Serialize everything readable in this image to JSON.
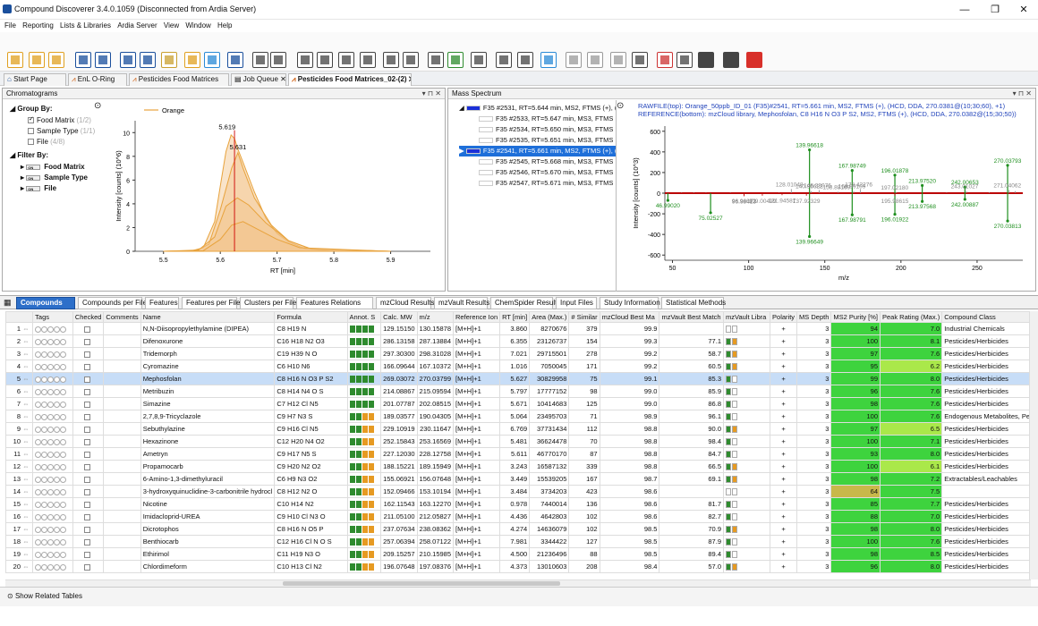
{
  "window": {
    "title": "Compound Discoverer 3.4.0.1059  (Disconnected from Ardia Server)",
    "minimize": "—",
    "maximize": "❐",
    "close": "✕"
  },
  "menu": [
    "File",
    "Reporting",
    "Lists & Libraries",
    "Ardia Server",
    "View",
    "Window",
    "Help"
  ],
  "doc_tabs": [
    {
      "label": "Start Page"
    },
    {
      "label": "EnL O-Ring"
    },
    {
      "label": "Pesticides Food Matrices"
    },
    {
      "label": "Job Queue"
    },
    {
      "label": "Pesticides Food Matrices_02-(2)"
    }
  ],
  "chromatograms": {
    "title": "Chromatograms",
    "group_by": "Group By:",
    "groups": [
      {
        "label": "Food Matrix",
        "count": "(1/2)",
        "checked": true
      },
      {
        "label": "Sample Type",
        "count": "(1/1)",
        "checked": false
      },
      {
        "label": "File",
        "count": "(4/8)",
        "checked": false
      }
    ],
    "filter_by": "Filter By:",
    "filters": [
      "Food Matrix",
      "Sample Type",
      "File"
    ],
    "legend": "Orange",
    "xlabel": "RT [min]",
    "ylabel": "Intensity [counts] (10^6)",
    "peak_labels": [
      "5.619",
      "5.631"
    ],
    "switch_text": "ON"
  },
  "chart_data": [
    {
      "type": "line",
      "title": "",
      "xlabel": "RT [min]",
      "ylabel": "Intensity [counts] (10^6)",
      "xlim": [
        5.45,
        5.97
      ],
      "ylim": [
        0,
        11
      ],
      "xticks": [
        5.5,
        5.6,
        5.7,
        5.8,
        5.9
      ],
      "yticks": [
        0,
        2,
        4,
        6,
        8,
        10
      ],
      "series": [
        {
          "name": "Orange",
          "x": [
            5.5,
            5.55,
            5.57,
            5.59,
            5.6,
            5.61,
            5.619,
            5.625,
            5.631,
            5.64,
            5.66,
            5.68,
            5.7,
            5.72,
            5.75,
            5.8,
            5.9
          ],
          "y": [
            0,
            0.05,
            0.3,
            2.5,
            5.5,
            8.4,
            9.8,
            9.5,
            8.6,
            7.5,
            5.0,
            2.8,
            1.5,
            0.8,
            0.2,
            0,
            0
          ]
        },
        {
          "name": "",
          "x": [
            5.5,
            5.56,
            5.58,
            5.6,
            5.62,
            5.631,
            5.64,
            5.66,
            5.69,
            5.72,
            5.76,
            5.9
          ],
          "y": [
            0,
            0.1,
            0.6,
            3.5,
            7.0,
            8.3,
            7.0,
            4.5,
            2.2,
            0.9,
            0.2,
            0
          ]
        },
        {
          "name": "",
          "x": [
            5.5,
            5.56,
            5.59,
            5.61,
            5.63,
            5.65,
            5.68,
            5.72,
            5.76,
            5.9
          ],
          "y": [
            0,
            0.05,
            1.2,
            3.8,
            4.5,
            3.9,
            2.4,
            0.9,
            0.2,
            0
          ]
        },
        {
          "name": "",
          "x": [
            5.5,
            5.57,
            5.6,
            5.62,
            5.64,
            5.66,
            5.7,
            5.74,
            5.9
          ],
          "y": [
            0,
            0.05,
            1.0,
            2.2,
            2.5,
            2.0,
            1.0,
            0.3,
            0
          ]
        }
      ]
    },
    {
      "type": "bar",
      "title": "",
      "xlabel": "m/z",
      "ylabel": "Intensity [counts] (10^3)",
      "xlim": [
        45,
        280
      ],
      "ylim": [
        -650,
        650
      ],
      "xticks": [
        50,
        100,
        150,
        200,
        250
      ],
      "yticks": [
        -600,
        -400,
        -200,
        0,
        200,
        400,
        600
      ],
      "series": [
        {
          "name": "top",
          "x": [
            139.96618,
            167.98749,
            196.01878,
            270.03793,
            213.9752,
            242.00653,
            128.01048,
            146.33076,
            173.42276,
            197.0218,
            243.01027,
            271.04062,
            140.96622,
            168.99109,
            158.88169,
            56.0,
            64.0,
            72.0,
            88.0,
            120.0,
            230.0,
            258.0,
            275.0
          ],
          "y": [
            420,
            220,
            175,
            270,
            75,
            60,
            40,
            30,
            40,
            10,
            20,
            30,
            20,
            20,
            15,
            5,
            6,
            4,
            5,
            5,
            5,
            10,
            20
          ]
        },
        {
          "name": "bottom",
          "x": [
            139.96649,
            167.98791,
            196.01922,
            270.03813,
            213.97568,
            242.00887,
            75.02527,
            46.9902,
            96.96072,
            96.98413,
            109.00499,
            121.94587,
            137.92329,
            195.98615
          ],
          "y": [
            -420,
            -210,
            -205,
            -270,
            -80,
            -60,
            -190,
            -70,
            -25,
            -30,
            -25,
            -20,
            -25,
            -25
          ]
        }
      ]
    }
  ],
  "mass_spectrum": {
    "title": "Mass Spectrum",
    "header_top": "RAWFILE(top): Orange_50ppb_ID_01 (F35)#2541, RT=5.661 min, MS2, FTMS (+), (HCD, DDA, 270.0381@(10;30;60), +1)",
    "header_bottom": "REFERENCE(bottom): mzCloud library, Mephosfolan, C8 H16 N O3 P S2, MS2, FTMS (+), (HCD, DDA, 270.0382@(15;30;50))",
    "xlabel": "m/z",
    "ylabel": "Intensity [counts] (10^3)",
    "peak_labels_top": [
      "139.96618",
      "167.98749",
      "196.01878",
      "270.03793",
      "213.97520",
      "242.00653",
      "128.01048",
      "146.33076",
      "173.42276",
      "197.02180",
      "243.01027",
      "271.04062",
      "140.96622",
      "168.99109",
      "158.88169"
    ],
    "peak_labels_bottom": [
      "139.96649",
      "167.98791",
      "196.01922",
      "270.03813",
      "213.97568",
      "242.00887",
      "75.02527",
      "46.99020",
      "96.96072",
      "96.98413",
      "109.00499",
      "121.94587",
      "137.92329",
      "195.98615"
    ],
    "scans": [
      {
        "label": "F35 #2531, RT=5.644 min, MS2, FTMS (+), (HCD",
        "level": 0,
        "selected": false,
        "colored": true
      },
      {
        "label": "F35 #2533, RT=5.647 min, MS3, FTMS (+), (",
        "level": 1,
        "selected": false,
        "colored": false
      },
      {
        "label": "F35 #2534, RT=5.650 min, MS3, FTMS (+), (",
        "level": 1,
        "selected": false,
        "colored": false
      },
      {
        "label": "F35 #2535, RT=5.651 min, MS3, FTMS (+), (",
        "level": 1,
        "selected": false,
        "colored": false
      },
      {
        "label": "F35 #2541, RT=5.661 min, MS2, FTMS (+), (HCD",
        "level": 0,
        "selected": true,
        "colored": true
      },
      {
        "label": "F35 #2545, RT=5.668 min, MS3, FTMS (+), (",
        "level": 1,
        "selected": false,
        "colored": false
      },
      {
        "label": "F35 #2546, RT=5.670 min, MS3, FTMS (+), (",
        "level": 1,
        "selected": false,
        "colored": false
      },
      {
        "label": "F35 #2547, RT=5.671 min, MS3, FTMS (+), (",
        "level": 1,
        "selected": false,
        "colored": false
      }
    ]
  },
  "result_tabs": [
    "Compounds",
    "Compounds per File",
    "Features",
    "Features per File",
    "Clusters per File",
    "Features Relations",
    "mzCloud Results",
    "mzVault Results",
    "ChemSpider Results",
    "Input Files",
    "Study Information",
    "Statistical Methods"
  ],
  "columns": [
    "",
    "Tags",
    "Checked",
    "Comments",
    "Name",
    "Formula",
    "Annot. S",
    "Calc. MW",
    "m/z",
    "Reference Ion",
    "RT [min]",
    "Area (Max.)",
    "# Similar",
    "mzCloud Best Ma",
    "mzVault Best Match",
    "mzVault Libra",
    "Polarity",
    "MS Depth",
    "MS2 Purity [%]",
    "Peak Rating (Max.)",
    "Compound Class"
  ],
  "rows": [
    {
      "n": "1",
      "name": "N,N-Diisopropylethylamine (DIPEA)",
      "formula": "C8 H19 N",
      "mw": "129.15150",
      "mz": "130.15878",
      "ion": "[M+H]+1",
      "rt": "3.860",
      "area": "8270676",
      "sim": "379",
      "cloud": "99.9",
      "vault": "",
      "pol": "+",
      "depth": "3",
      "purity": "94",
      "rating": "7.0",
      "cls": "Industrial Chemicals",
      "annot": "gggg",
      "lib": "ww"
    },
    {
      "n": "2",
      "name": "Difenoxurone",
      "formula": "C16 H18 N2 O3",
      "mw": "286.13158",
      "mz": "287.13884",
      "ion": "[M+H]+1",
      "rt": "6.355",
      "area": "23126737",
      "sim": "154",
      "cloud": "99.3",
      "vault": "77.1",
      "pol": "+",
      "depth": "3",
      "purity": "100",
      "rating": "8.1",
      "cls": "Pesticides/Herbicides",
      "annot": "gggg",
      "lib": "go"
    },
    {
      "n": "3",
      "name": "Tridemorph",
      "formula": "C19 H39 N O",
      "mw": "297.30300",
      "mz": "298.31028",
      "ion": "[M+H]+1",
      "rt": "7.021",
      "area": "29715501",
      "sim": "278",
      "cloud": "99.2",
      "vault": "58.7",
      "pol": "+",
      "depth": "3",
      "purity": "97",
      "rating": "7.6",
      "cls": "Pesticides/Herbicides",
      "annot": "gggg",
      "lib": "go"
    },
    {
      "n": "4",
      "name": "Cyromazine",
      "formula": "C6 H10 N6",
      "mw": "166.09644",
      "mz": "167.10372",
      "ion": "[M+H]+1",
      "rt": "1.016",
      "area": "7050045",
      "sim": "171",
      "cloud": "99.2",
      "vault": "60.5",
      "pol": "+",
      "depth": "3",
      "purity": "95",
      "rating": "6.2",
      "cls": "Pesticides/Herbicides",
      "annot": "gggg",
      "lib": "go"
    },
    {
      "n": "5",
      "name": "Mephosfolan",
      "formula": "C8 H16 N O3 P S2",
      "mw": "269.03072",
      "mz": "270.03799",
      "ion": "[M+H]+1",
      "rt": "5.627",
      "area": "30829958",
      "sim": "75",
      "cloud": "99.1",
      "vault": "85.3",
      "pol": "+",
      "depth": "3",
      "purity": "99",
      "rating": "8.0",
      "cls": "Pesticides/Herbicides",
      "annot": "gggg",
      "lib": "gw",
      "sel": true
    },
    {
      "n": "6",
      "name": "Metribuzin",
      "formula": "C8 H14 N4 O S",
      "mw": "214.08867",
      "mz": "215.09594",
      "ion": "[M+H]+1",
      "rt": "5.797",
      "area": "17777152",
      "sim": "98",
      "cloud": "99.0",
      "vault": "85.9",
      "pol": "+",
      "depth": "3",
      "purity": "96",
      "rating": "7.6",
      "cls": "Pesticides/Herbicides",
      "annot": "gggg",
      "lib": "gw"
    },
    {
      "n": "7",
      "name": "Simazine",
      "formula": "C7 H12 Cl N5",
      "mw": "201.07787",
      "mz": "202.08515",
      "ion": "[M+H]+1",
      "rt": "5.671",
      "area": "10414683",
      "sim": "125",
      "cloud": "99.0",
      "vault": "86.8",
      "pol": "+",
      "depth": "3",
      "purity": "98",
      "rating": "7.6",
      "cls": "Pesticides/Herbicides",
      "annot": "gggg",
      "lib": "gw"
    },
    {
      "n": "8",
      "name": "2,7,8,9-Tricyclazole",
      "formula": "C9 H7 N3 S",
      "mw": "189.03577",
      "mz": "190.04305",
      "ion": "[M+H]+1",
      "rt": "5.064",
      "area": "23495703",
      "sim": "71",
      "cloud": "98.9",
      "vault": "96.1",
      "pol": "+",
      "depth": "3",
      "purity": "100",
      "rating": "7.6",
      "cls": "Endogenous Metabolites, Pest",
      "annot": "ggoo",
      "lib": "gw"
    },
    {
      "n": "9",
      "name": "Sebuthylazine",
      "formula": "C9 H16 Cl N5",
      "mw": "229.10919",
      "mz": "230.11647",
      "ion": "[M+H]+1",
      "rt": "6.769",
      "area": "37731434",
      "sim": "112",
      "cloud": "98.8",
      "vault": "90.0",
      "pol": "+",
      "depth": "3",
      "purity": "97",
      "rating": "6.5",
      "cls": "Pesticides/Herbicides",
      "annot": "ggoo",
      "lib": "go"
    },
    {
      "n": "10",
      "name": "Hexazinone",
      "formula": "C12 H20 N4 O2",
      "mw": "252.15843",
      "mz": "253.16569",
      "ion": "[M+H]+1",
      "rt": "5.481",
      "area": "36624478",
      "sim": "70",
      "cloud": "98.8",
      "vault": "98.4",
      "pol": "+",
      "depth": "3",
      "purity": "100",
      "rating": "7.1",
      "cls": "Pesticides/Herbicides",
      "annot": "ggoo",
      "lib": "gw"
    },
    {
      "n": "11",
      "name": "Ametryn",
      "formula": "C9 H17 N5 S",
      "mw": "227.12030",
      "mz": "228.12758",
      "ion": "[M+H]+1",
      "rt": "5.611",
      "area": "46770170",
      "sim": "87",
      "cloud": "98.8",
      "vault": "84.7",
      "pol": "+",
      "depth": "3",
      "purity": "93",
      "rating": "8.0",
      "cls": "Pesticides/Herbicides",
      "annot": "ggoo",
      "lib": "gw"
    },
    {
      "n": "12",
      "name": "Propamocarb",
      "formula": "C9 H20 N2 O2",
      "mw": "188.15221",
      "mz": "189.15949",
      "ion": "[M+H]+1",
      "rt": "3.243",
      "area": "16587132",
      "sim": "339",
      "cloud": "98.8",
      "vault": "66.5",
      "pol": "+",
      "depth": "3",
      "purity": "100",
      "rating": "6.1",
      "cls": "Pesticides/Herbicides",
      "annot": "ggoo",
      "lib": "go"
    },
    {
      "n": "13",
      "name": "6-Amino-1,3-dimethyluracil",
      "formula": "C6 H9 N3 O2",
      "mw": "155.06921",
      "mz": "156.07648",
      "ion": "[M+H]+1",
      "rt": "3.449",
      "area": "15539205",
      "sim": "167",
      "cloud": "98.7",
      "vault": "69.1",
      "pol": "+",
      "depth": "3",
      "purity": "98",
      "rating": "7.2",
      "cls": "Extractables/Leachables",
      "annot": "ggoo",
      "lib": "go"
    },
    {
      "n": "14",
      "name": "3-hydroxyquinuclidine-3-carbonitrile hydrocl",
      "formula": "C8 H12 N2 O",
      "mw": "152.09466",
      "mz": "153.10194",
      "ion": "[M+H]+1",
      "rt": "3.484",
      "area": "3734203",
      "sim": "423",
      "cloud": "98.6",
      "vault": "",
      "pol": "+",
      "depth": "3",
      "purity": "64",
      "rating": "7.5",
      "cls": "",
      "annot": "ggoo",
      "lib": "ww"
    },
    {
      "n": "15",
      "name": "Nicotine",
      "formula": "C10 H14 N2",
      "mw": "162.11543",
      "mz": "163.12270",
      "ion": "[M+H]+1",
      "rt": "0.978",
      "area": "7440014",
      "sim": "136",
      "cloud": "98.6",
      "vault": "81.7",
      "pol": "+",
      "depth": "3",
      "purity": "85",
      "rating": "7.7",
      "cls": "Pesticides/Herbicides",
      "annot": "ggoo",
      "lib": "gw"
    },
    {
      "n": "16",
      "name": "Imidacloprid-UREA",
      "formula": "C9 H10 Cl N3 O",
      "mw": "211.05100",
      "mz": "212.05827",
      "ion": "[M+H]+1",
      "rt": "4.436",
      "area": "4642803",
      "sim": "102",
      "cloud": "98.6",
      "vault": "82.7",
      "pol": "+",
      "depth": "3",
      "purity": "88",
      "rating": "7.0",
      "cls": "Pesticides/Herbicides",
      "annot": "ggoo",
      "lib": "gw"
    },
    {
      "n": "17",
      "name": "Dicrotophos",
      "formula": "C8 H16 N O5 P",
      "mw": "237.07634",
      "mz": "238.08362",
      "ion": "[M+H]+1",
      "rt": "4.274",
      "area": "14636079",
      "sim": "102",
      "cloud": "98.5",
      "vault": "70.9",
      "pol": "+",
      "depth": "3",
      "purity": "98",
      "rating": "8.0",
      "cls": "Pesticides/Herbicides",
      "annot": "ggoo",
      "lib": "go"
    },
    {
      "n": "18",
      "name": "Benthiocarb",
      "formula": "C12 H16 Cl N O S",
      "mw": "257.06394",
      "mz": "258.07122",
      "ion": "[M+H]+1",
      "rt": "7.981",
      "area": "3344422",
      "sim": "127",
      "cloud": "98.5",
      "vault": "87.9",
      "pol": "+",
      "depth": "3",
      "purity": "100",
      "rating": "7.6",
      "cls": "Pesticides/Herbicides",
      "annot": "ggoo",
      "lib": "gw"
    },
    {
      "n": "19",
      "name": "Ethirimol",
      "formula": "C11 H19 N3 O",
      "mw": "209.15257",
      "mz": "210.15985",
      "ion": "[M+H]+1",
      "rt": "4.500",
      "area": "21236496",
      "sim": "88",
      "cloud": "98.5",
      "vault": "89.4",
      "pol": "+",
      "depth": "3",
      "purity": "98",
      "rating": "8.5",
      "cls": "Pesticides/Herbicides",
      "annot": "ggoo",
      "lib": "gw"
    },
    {
      "n": "20",
      "name": "Chlordimeform",
      "formula": "C10 H13 Cl N2",
      "mw": "196.07648",
      "mz": "197.08376",
      "ion": "[M+H]+1",
      "rt": "4.373",
      "area": "13010603",
      "sim": "208",
      "cloud": "98.4",
      "vault": "57.0",
      "pol": "+",
      "depth": "3",
      "purity": "96",
      "rating": "8.0",
      "cls": "Pesticides/Herbicides",
      "annot": "ggoo",
      "lib": "go"
    }
  ],
  "status": {
    "related": "Show Related Tables"
  },
  "colors": {
    "accent": "#2d6fc9",
    "orange": "#e8a33d",
    "green_dark": "#2e8b2e",
    "green_light": "#aae84a",
    "purity_green": "#3ed33e"
  }
}
